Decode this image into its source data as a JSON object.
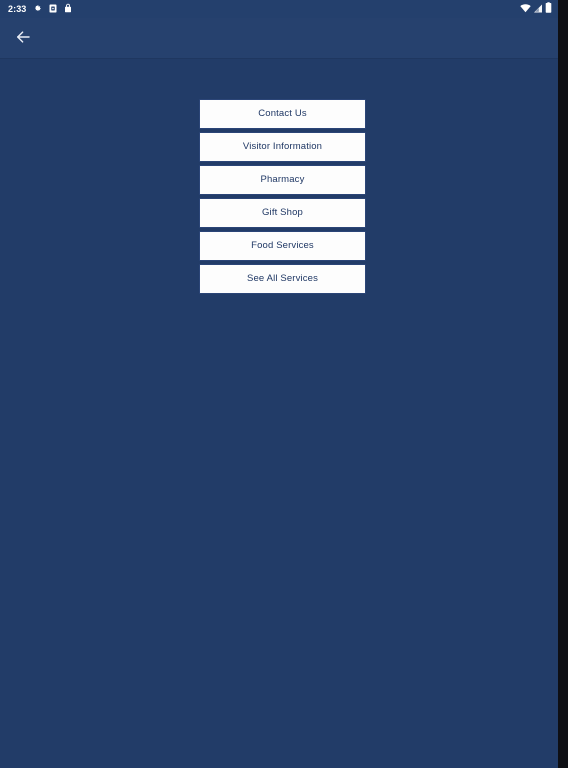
{
  "status_bar": {
    "clock": "2:33",
    "left_icons": [
      {
        "name": "gear-icon",
        "label": "settings"
      },
      {
        "name": "sd-card-icon",
        "label": "storage"
      },
      {
        "name": "lock-icon",
        "label": "lock"
      }
    ],
    "right_icons": [
      {
        "name": "wifi-icon",
        "label": "wifi"
      },
      {
        "name": "cellular-signal-icon",
        "label": "signal"
      },
      {
        "name": "battery-icon",
        "label": "battery"
      }
    ]
  },
  "app_bar": {
    "back_icon": "arrow-left-icon",
    "title": ""
  },
  "menu": {
    "items": [
      {
        "label": "Contact Us"
      },
      {
        "label": "Visitor Information"
      },
      {
        "label": "Pharmacy"
      },
      {
        "label": "Gift Shop"
      },
      {
        "label": "Food Services"
      },
      {
        "label": "See All Services"
      }
    ]
  },
  "colors": {
    "background": "#223c68",
    "app_bar": "#26416e",
    "status_bar": "#24406d",
    "button_background": "#fdfdfd",
    "button_border": "#2b4577",
    "button_text": "#1f3764",
    "status_text": "#ffffff"
  }
}
